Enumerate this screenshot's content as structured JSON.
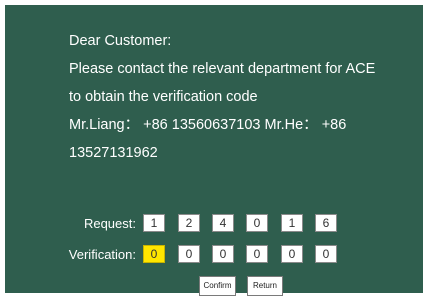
{
  "message": {
    "greeting": "Dear Customer:",
    "line1": "Please contact the relevant department  for ACE",
    "line2": "to obtain the verification code",
    "line3": "Mr.Liang： +86 13560637103  Mr.He： +86",
    "line4": "13527131962"
  },
  "request": {
    "label": "Request:",
    "digits": [
      "1",
      "2",
      "4",
      "0",
      "1",
      "6"
    ]
  },
  "verification": {
    "label": "Verification:",
    "digits": [
      "0",
      "0",
      "0",
      "0",
      "0",
      "0"
    ],
    "active_index": 0
  },
  "buttons": {
    "confirm": "Confirm",
    "return": "Return"
  },
  "colors": {
    "panel_bg": "#2f5e4e",
    "active_field": "#ffe600"
  }
}
